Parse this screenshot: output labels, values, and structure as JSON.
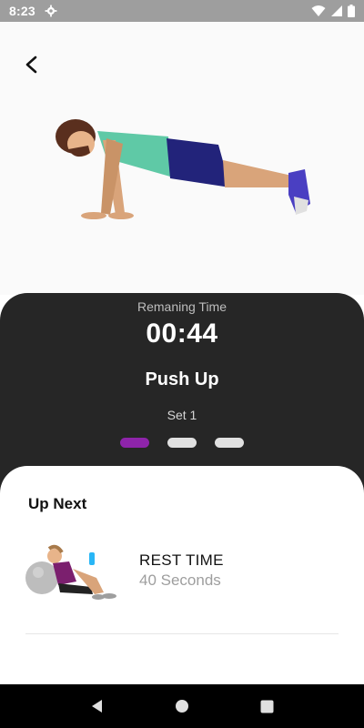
{
  "status_bar": {
    "time": "8:23",
    "icons": [
      "settings-icon",
      "wifi-icon",
      "signal-icon",
      "battery-icon"
    ]
  },
  "header": {
    "back_icon": "back-arrow-icon"
  },
  "exercise": {
    "image": "push-up-illustration",
    "remaining_label": "Remaning Time",
    "time": "00:44",
    "name": "Push Up",
    "set_label": "Set 1",
    "sets_total": 3,
    "current_set_index": 0
  },
  "up_next": {
    "title": "Up Next",
    "item_title": "REST TIME",
    "item_subtitle": "40 Seconds",
    "item_image": "rest-illustration"
  },
  "nav_bar": {
    "icons": [
      "back-triangle-icon",
      "home-circle-icon",
      "recents-square-icon"
    ]
  },
  "colors": {
    "panel_dark": "#262626",
    "accent": "#8e24aa",
    "status_bar": "#9e9e9e"
  }
}
